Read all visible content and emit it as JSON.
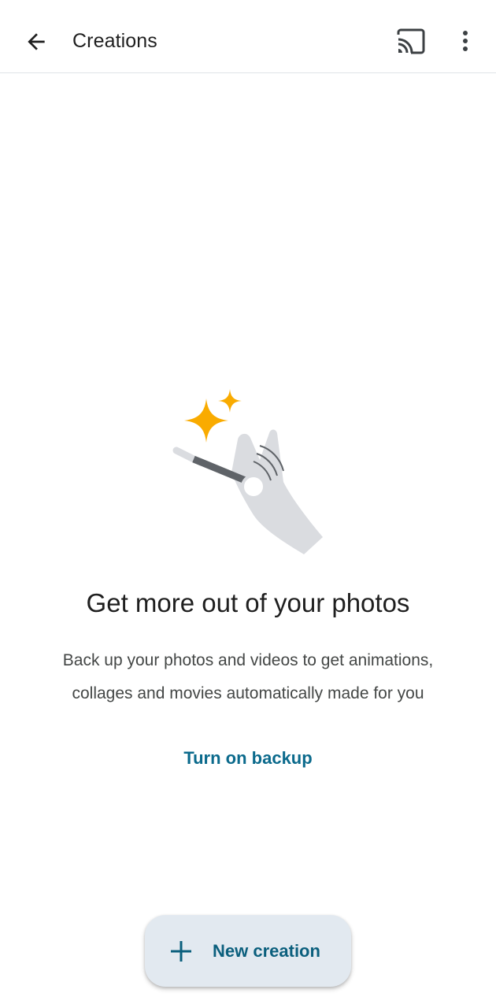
{
  "app_bar": {
    "title": "Creations",
    "icons": {
      "back": "arrow-back-icon",
      "cast": "cast-icon",
      "more": "more-vert-icon"
    }
  },
  "empty_state": {
    "illustration": "magic-wand-hand-sparkles-illustration",
    "headline": "Get more out of your photos",
    "body_line_1": "Back up your photos and videos to get animations,",
    "body_line_2": "collages and movies automatically made for you",
    "action_label": "Turn on backup"
  },
  "fab": {
    "icon": "plus-icon",
    "label": "New creation"
  },
  "colors": {
    "accent_link": "#0b6a8c",
    "fab_background": "#e2e9f0",
    "sparkle": "#f9ab00",
    "hand": "#dadce0",
    "wand": "#5f6368"
  }
}
